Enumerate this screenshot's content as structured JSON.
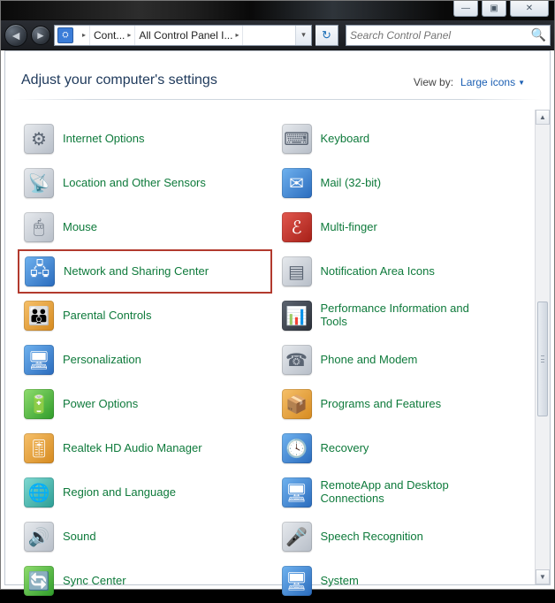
{
  "window_controls": {
    "min": "—",
    "max": "▣",
    "close": "✕"
  },
  "nav": {
    "back_glyph": "◄",
    "forward_glyph": "►"
  },
  "address": {
    "segments": [
      "Cont...",
      "All Control Panel I..."
    ],
    "arrow": "▸",
    "dropdown": "▾",
    "refresh": "↻"
  },
  "search": {
    "placeholder": "Search Control Panel",
    "icon": "🔍"
  },
  "header": {
    "title": "Adjust your computer's settings",
    "viewby_label": "View by:",
    "viewby_value": "Large icons"
  },
  "items": [
    {
      "label": "Internet Options",
      "icon_glyph": "⚙",
      "icon_cls": "ic-gray",
      "name": "internet-options",
      "highlight": false
    },
    {
      "label": "Keyboard",
      "icon_glyph": "⌨",
      "icon_cls": "ic-gray",
      "name": "keyboard",
      "highlight": false
    },
    {
      "label": "Location and Other Sensors",
      "icon_glyph": "📡",
      "icon_cls": "ic-gray",
      "name": "location-sensors",
      "highlight": false
    },
    {
      "label": "Mail (32-bit)",
      "icon_glyph": "✉",
      "icon_cls": "ic-blue",
      "name": "mail-32bit",
      "highlight": false
    },
    {
      "label": "Mouse",
      "icon_glyph": "🖱",
      "icon_cls": "ic-gray",
      "name": "mouse",
      "highlight": false
    },
    {
      "label": "Multi-finger",
      "icon_glyph": "ℰ",
      "icon_cls": "ic-red",
      "name": "multi-finger",
      "highlight": false
    },
    {
      "label": "Network and Sharing Center",
      "icon_glyph": "🖧",
      "icon_cls": "ic-blue",
      "name": "network-sharing-center",
      "highlight": true
    },
    {
      "label": "Notification Area Icons",
      "icon_glyph": "▤",
      "icon_cls": "ic-gray",
      "name": "notification-area-icons",
      "highlight": false
    },
    {
      "label": "Parental Controls",
      "icon_glyph": "👪",
      "icon_cls": "ic-orange",
      "name": "parental-controls",
      "highlight": false
    },
    {
      "label": "Performance Information and Tools",
      "icon_glyph": "📊",
      "icon_cls": "ic-dark",
      "name": "performance-info-tools",
      "highlight": false
    },
    {
      "label": "Personalization",
      "icon_glyph": "🖥",
      "icon_cls": "ic-blue",
      "name": "personalization",
      "highlight": false
    },
    {
      "label": "Phone and Modem",
      "icon_glyph": "☎",
      "icon_cls": "ic-gray",
      "name": "phone-modem",
      "highlight": false
    },
    {
      "label": "Power Options",
      "icon_glyph": "🔋",
      "icon_cls": "ic-green",
      "name": "power-options",
      "highlight": false
    },
    {
      "label": "Programs and Features",
      "icon_glyph": "📦",
      "icon_cls": "ic-orange",
      "name": "programs-features",
      "highlight": false
    },
    {
      "label": "Realtek HD Audio Manager",
      "icon_glyph": "🎚",
      "icon_cls": "ic-orange",
      "name": "realtek-audio-manager",
      "highlight": false
    },
    {
      "label": "Recovery",
      "icon_glyph": "🕓",
      "icon_cls": "ic-blue",
      "name": "recovery",
      "highlight": false
    },
    {
      "label": "Region and Language",
      "icon_glyph": "🌐",
      "icon_cls": "ic-teal",
      "name": "region-language",
      "highlight": false
    },
    {
      "label": "RemoteApp and Desktop Connections",
      "icon_glyph": "🖥",
      "icon_cls": "ic-blue",
      "name": "remoteapp-desktop",
      "highlight": false
    },
    {
      "label": "Sound",
      "icon_glyph": "🔊",
      "icon_cls": "ic-gray",
      "name": "sound",
      "highlight": false
    },
    {
      "label": "Speech Recognition",
      "icon_glyph": "🎤",
      "icon_cls": "ic-gray",
      "name": "speech-recognition",
      "highlight": false
    },
    {
      "label": "Sync Center",
      "icon_glyph": "🔄",
      "icon_cls": "ic-green",
      "name": "sync-center",
      "highlight": false
    },
    {
      "label": "System",
      "icon_glyph": "🖥",
      "icon_cls": "ic-blue",
      "name": "system",
      "highlight": false
    }
  ],
  "scroll": {
    "up": "▲",
    "down": "▼"
  }
}
